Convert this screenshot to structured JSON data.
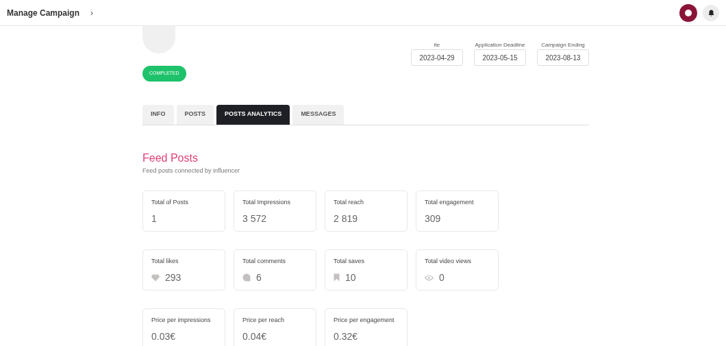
{
  "breadcrumb": {
    "title": "Manage Campaign",
    "separator": "›"
  },
  "status": "COMPLETED",
  "dates": [
    {
      "label": "ite",
      "value": "2023-04-29"
    },
    {
      "label": "Application Deadline",
      "value": "2023-05-15"
    },
    {
      "label": "Campaign Ending",
      "value": "2023-08-13"
    }
  ],
  "tabs": [
    {
      "label": "INFO",
      "selected": false
    },
    {
      "label": "POSTS",
      "selected": false
    },
    {
      "label": "POSTS ANALYTICS",
      "selected": true
    },
    {
      "label": "MESSAGES",
      "selected": false
    }
  ],
  "section": {
    "title": "Feed Posts",
    "subtitle": "Feed posts connected by influencer"
  },
  "stat_rows": [
    [
      {
        "label": "Total of Posts",
        "value": "1",
        "kind": "plain"
      },
      {
        "label": "Total Impressions",
        "value": "3 572",
        "kind": "plain"
      },
      {
        "label": "Total reach",
        "value": "2 819",
        "kind": "plain"
      },
      {
        "label": "Total engagement",
        "value": "309",
        "kind": "plain"
      }
    ],
    [
      {
        "label": "Total likes",
        "value": "293",
        "kind": "heart"
      },
      {
        "label": "Total comments",
        "value": "6",
        "kind": "comment"
      },
      {
        "label": "Total saves",
        "value": "10",
        "kind": "bookmark"
      },
      {
        "label": "Total video views",
        "value": "0",
        "kind": "eye"
      }
    ],
    [
      {
        "label": "Price per impressions",
        "value": "0.03€",
        "kind": "plain"
      },
      {
        "label": "Price per reach",
        "value": "0.04€",
        "kind": "plain"
      },
      {
        "label": "Price per engagement",
        "value": "0.32€",
        "kind": "plain"
      }
    ]
  ]
}
